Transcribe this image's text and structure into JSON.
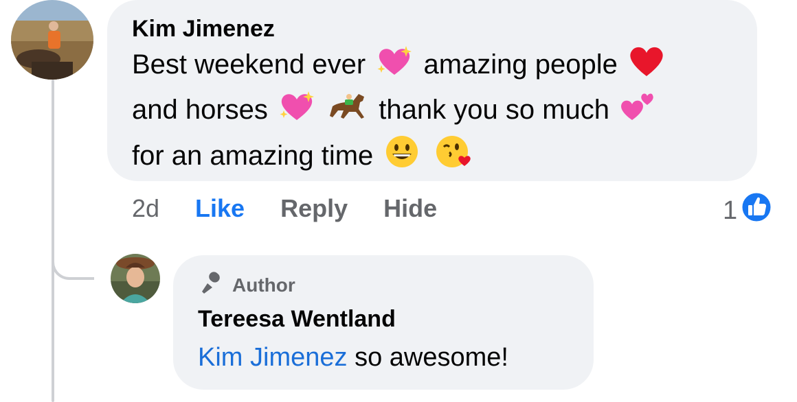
{
  "comment": {
    "author": "Kim Jimenez",
    "line1_a": "Best weekend ever",
    "line1_b": "amazing people",
    "line2_a": "and horses",
    "line2_b": "thank you so much",
    "line3_a": "for an amazing time",
    "emoji": [
      "sparkling-heart",
      "red-heart",
      "sparkling-heart",
      "horse-racing",
      "two-hearts",
      "grinning-face",
      "face-blowing-kiss"
    ]
  },
  "actions": {
    "time": "2d",
    "like": "Like",
    "reply": "Reply",
    "hide": "Hide"
  },
  "reactions": {
    "count": "1",
    "icon": "like-thumb-icon",
    "color": "#1877f2"
  },
  "reply": {
    "badge": "Author",
    "badge_icon": "microphone-icon",
    "author": "Tereesa Wentland",
    "mention": "Kim Jimenez",
    "text": "so awesome!"
  },
  "colors": {
    "link": "#1877f2",
    "bubble": "#f0f2f5",
    "meta": "#65676b"
  }
}
